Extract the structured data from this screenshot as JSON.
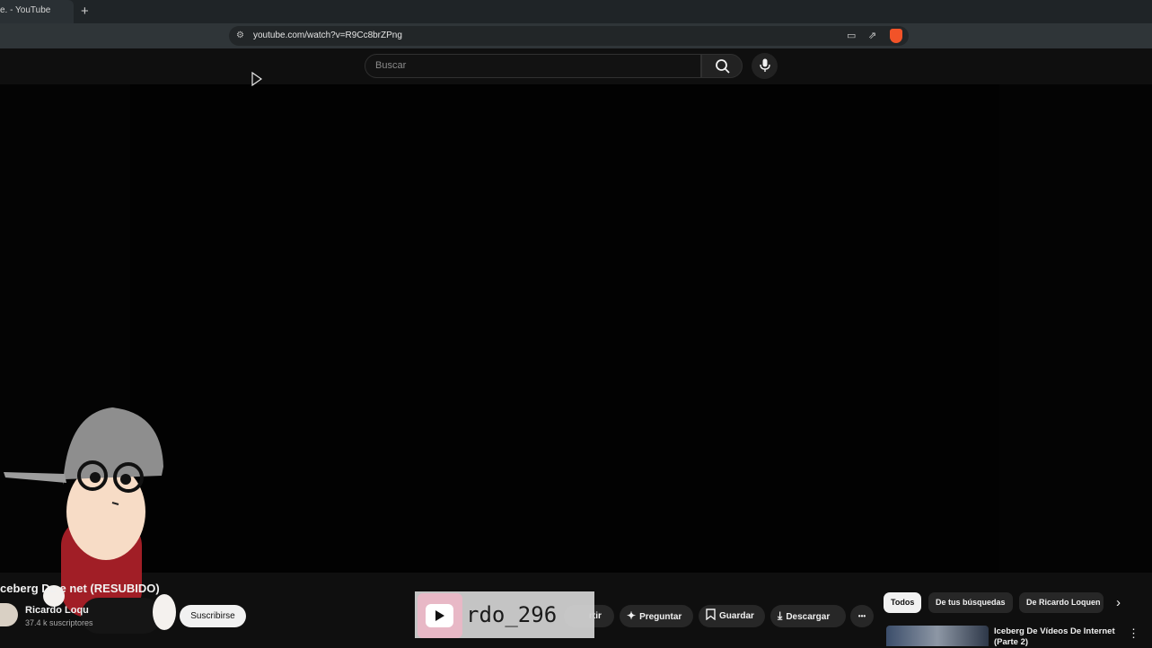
{
  "browser": {
    "tab_title": "e. - YouTube",
    "new_tab_glyph": "+",
    "url": "youtube.com/watch?v=R9Cc8brZPng",
    "icons": [
      "site-info-icon",
      "cast-icon",
      "share-icon",
      "brave-shield-icon"
    ]
  },
  "masthead": {
    "search_placeholder": "Buscar",
    "icons": [
      "search-icon",
      "mic-icon"
    ]
  },
  "video": {
    "title": "ceberg De  e  net (RESUBIDO)",
    "channel_name": "Ricardo Loqu",
    "subscribers": "37.4 k suscriptores",
    "subscribe_label": "Suscribirse"
  },
  "actions": {
    "share_partial": "rtir",
    "ask_label": "Preguntar",
    "save_label": "Guardar",
    "download_label": "Descargar",
    "more_glyph": "•••"
  },
  "chips": {
    "all": "Todos",
    "from_searches": "De tus búsquedas",
    "from_channel": "De Ricardo Loquen",
    "next_glyph": "›"
  },
  "recommendation": {
    "title": "Iceberg De Vídeos De Internet (Parte 2)",
    "menu_glyph": "⋮"
  },
  "overlay": {
    "streamer_name": "rdo_296"
  },
  "colors": {
    "background": "#0f0f0f",
    "chip_active": "#f1f1f1",
    "overlay_logo": "#e8b8c6"
  }
}
